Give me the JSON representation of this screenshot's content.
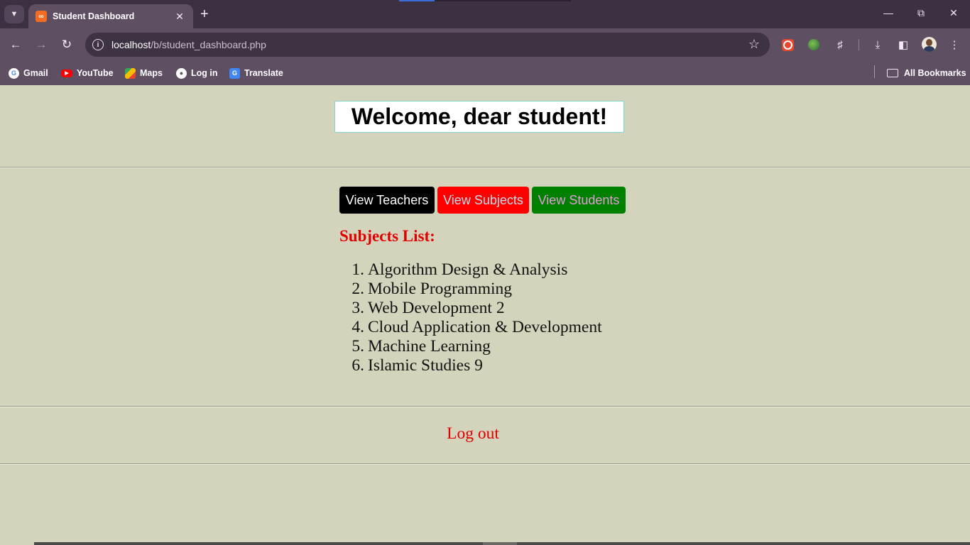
{
  "browser": {
    "tab_title": "Student Dashboard",
    "url_host": "localhost",
    "url_path": "/b/student_dashboard.php",
    "bookmarks": [
      {
        "label": "Gmail"
      },
      {
        "label": "YouTube"
      },
      {
        "label": "Maps"
      },
      {
        "label": "Log in"
      },
      {
        "label": "Translate"
      }
    ],
    "all_bookmarks_label": "All Bookmarks"
  },
  "page": {
    "welcome_heading": "Welcome, dear student!",
    "nav_buttons": {
      "teachers": "View Teachers",
      "subjects": "View Subjects",
      "students": "View Students"
    },
    "subjects_heading": "Subjects List:",
    "subjects": [
      {
        "num": "1.",
        "name": "Algorithm Design & Analysis"
      },
      {
        "num": "2.",
        "name": "Mobile Programming"
      },
      {
        "num": "3.",
        "name": "Web Development 2"
      },
      {
        "num": "4.",
        "name": "Cloud Application & Development"
      },
      {
        "num": "5.",
        "name": "Machine Learning"
      },
      {
        "num": "6.",
        "name": "Islamic Studies 9"
      }
    ],
    "logout_label": "Log out"
  },
  "colors": {
    "page_background": "#d4d4bc",
    "accent_red": "#e00000",
    "teachers_button": "#000000",
    "subjects_button": "#ff0000",
    "students_button": "#008000"
  }
}
